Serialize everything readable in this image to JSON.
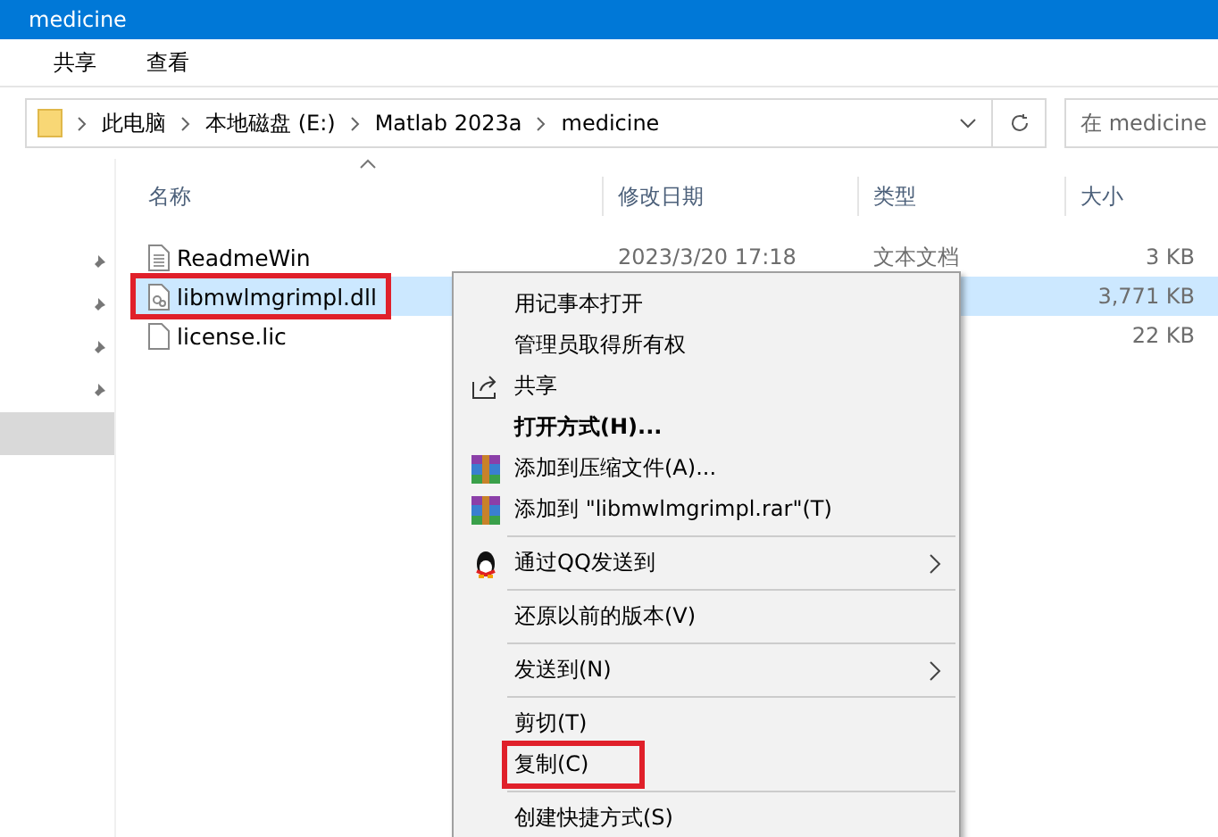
{
  "window": {
    "title": "medicine"
  },
  "ribbon": {
    "tabs": [
      {
        "label": "共享",
        "selected": false
      },
      {
        "label": "查看",
        "selected": false
      }
    ]
  },
  "address_bar": {
    "path": [
      "此电脑",
      "本地磁盘 (E:)",
      "Matlab 2023a",
      "medicine"
    ]
  },
  "search": {
    "placeholder": "在 medicine"
  },
  "nav_pane": {
    "items": [
      {
        "pinned": true,
        "selected": false
      },
      {
        "pinned": true,
        "selected": false
      },
      {
        "pinned": true,
        "selected": false
      },
      {
        "pinned": true,
        "selected": false
      },
      {
        "pinned": false,
        "selected": true
      }
    ]
  },
  "table": {
    "columns": [
      "名称",
      "修改日期",
      "类型",
      "大小"
    ],
    "rows": [
      {
        "kind": "text",
        "name": "ReadmeWin",
        "date": "2023/3/20 17:18",
        "type": "文本文档",
        "size": "3 KB",
        "selected": false,
        "highlighted": false
      },
      {
        "kind": "dll",
        "name": "libmwlmgrimpl.dll",
        "size": "3,771 KB",
        "selected": true,
        "highlighted": true
      },
      {
        "kind": "blank",
        "name": "license.lic",
        "size": "22 KB",
        "selected": false,
        "highlighted": false
      }
    ]
  },
  "context_menu": {
    "items": [
      {
        "kind": "plain",
        "label": "用记事本打开",
        "bold": false,
        "submenu": false,
        "highlighted": false
      },
      {
        "kind": "plain",
        "label": "管理员取得所有权",
        "bold": false,
        "submenu": false,
        "highlighted": false
      },
      {
        "kind": "share",
        "label": "共享",
        "bold": false,
        "submenu": false,
        "highlighted": false
      },
      {
        "kind": "plain",
        "label": "打开方式(H)...",
        "bold": true,
        "submenu": false,
        "highlighted": false
      },
      {
        "kind": "archive",
        "label": "添加到压缩文件(A)...",
        "bold": false,
        "submenu": false,
        "highlighted": false
      },
      {
        "kind": "archive",
        "label": "添加到 \"libmwlmgrimpl.rar\"(T)",
        "bold": false,
        "submenu": false,
        "highlighted": false
      },
      {
        "kind": "separator"
      },
      {
        "kind": "qq",
        "label": "通过QQ发送到",
        "bold": false,
        "submenu": true,
        "highlighted": false
      },
      {
        "kind": "separator"
      },
      {
        "kind": "plain",
        "label": "还原以前的版本(V)",
        "bold": false,
        "submenu": false,
        "highlighted": false
      },
      {
        "kind": "separator"
      },
      {
        "kind": "plain",
        "label": "发送到(N)",
        "bold": false,
        "submenu": true,
        "highlighted": false
      },
      {
        "kind": "separator"
      },
      {
        "kind": "plain",
        "label": "剪切(T)",
        "bold": false,
        "submenu": false,
        "highlighted": false
      },
      {
        "kind": "plain",
        "label": "复制(C)",
        "bold": false,
        "submenu": false,
        "highlighted": true
      },
      {
        "kind": "separator"
      },
      {
        "kind": "plain",
        "label": "创建快捷方式(S)",
        "bold": false,
        "submenu": false,
        "highlighted": false
      }
    ]
  }
}
